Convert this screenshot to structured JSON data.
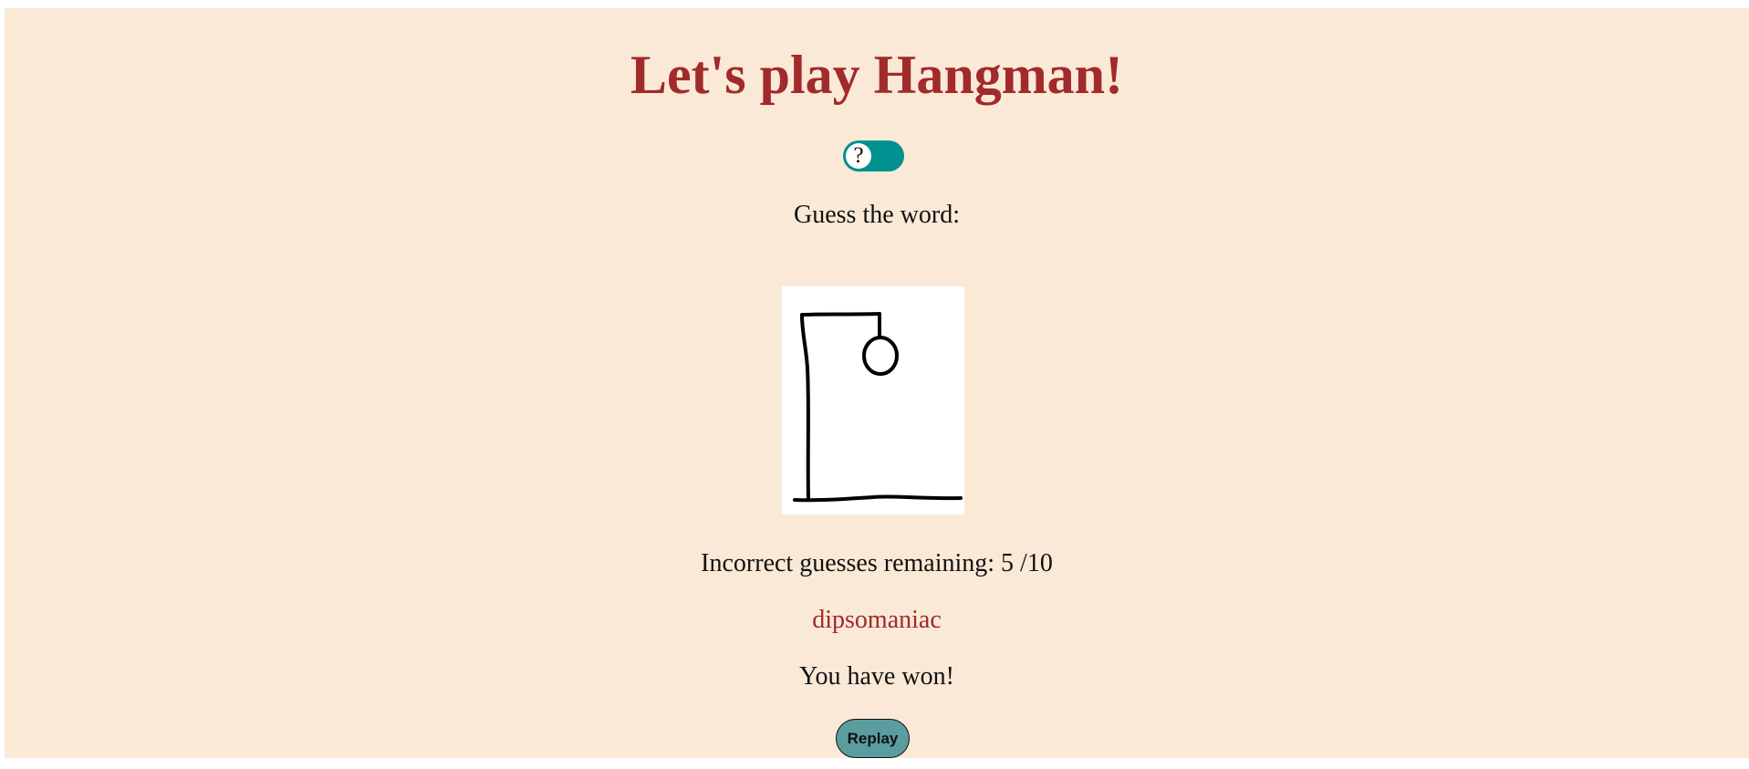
{
  "header": {
    "title": "Let's play Hangman!"
  },
  "help_toggle": {
    "icon": "question-mark-icon",
    "glyph": "?",
    "state": "on",
    "color": "#009090"
  },
  "game": {
    "guess_label": "Guess the word:",
    "hangman_drawing": {
      "parts_drawn": [
        "gallows-base",
        "gallows-pole",
        "gallows-beam",
        "rope",
        "head"
      ]
    },
    "remaining_text": "Incorrect guesses remaining: 5 /10",
    "answer_word": "dipsomaniac",
    "result_text": "You have won!",
    "replay_label": "Replay"
  },
  "colors": {
    "background": "#fae9d6",
    "title": "#a12a2a",
    "answer": "#a12a2a",
    "replay_button": "#5a9d9f"
  }
}
